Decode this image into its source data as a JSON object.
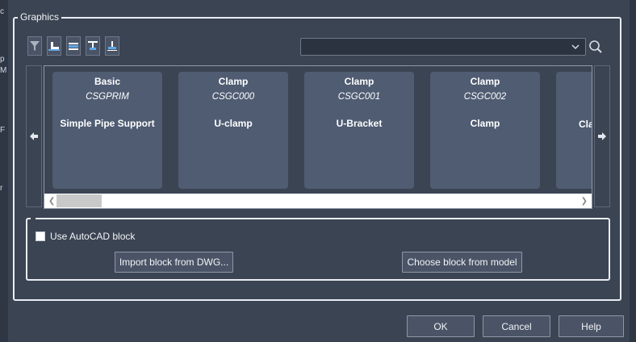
{
  "group": {
    "legend": "Graphics"
  },
  "toolbar": {
    "buttons": [
      {
        "icon": "filter-icon"
      },
      {
        "icon": "pipe-elbow-icon"
      },
      {
        "icon": "pipe-support-icon"
      },
      {
        "icon": "pipe-hanger-icon"
      },
      {
        "icon": "pipe-clamp-icon"
      }
    ],
    "search_value": ""
  },
  "gallery": {
    "cards": [
      {
        "category": "Basic",
        "code": "CSGPRIM",
        "description": "Simple Pipe Support"
      },
      {
        "category": "Clamp",
        "code": "CSGC000",
        "description": "U-clamp"
      },
      {
        "category": "Clamp",
        "code": "CSGC001",
        "description": "U-Bracket"
      },
      {
        "category": "Clamp",
        "code": "CSGC002",
        "description": "Clamp"
      },
      {
        "category": "",
        "code": "",
        "description": "Cla"
      }
    ]
  },
  "block": {
    "use_autocad_label": "Use AutoCAD block",
    "import_label": "Import block from DWG...",
    "choose_label": "Choose block from model"
  },
  "footer": {
    "ok_label": "OK",
    "cancel_label": "Cancel",
    "help_label": "Help"
  },
  "edge_fragments": {
    "left": [
      "c",
      "p",
      "M",
      "F",
      "r"
    ]
  },
  "colors": {
    "background": "#3b4453",
    "card": "#4f5c72",
    "border": "#e9edf2"
  }
}
